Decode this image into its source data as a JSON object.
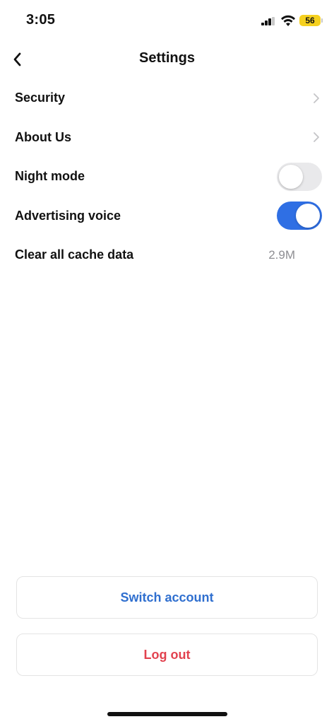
{
  "status_bar": {
    "time": "3:05",
    "battery": "56",
    "battery_color": "#f5d01f",
    "icons": [
      "signal-icon",
      "wifi-icon",
      "battery-icon"
    ]
  },
  "nav": {
    "title": "Settings",
    "back_icon": "chevron-left-icon"
  },
  "settings": {
    "security": {
      "label": "Security",
      "icon": "chevron-right-icon"
    },
    "about": {
      "label": "About Us",
      "icon": "chevron-right-icon"
    },
    "night_mode": {
      "label": "Night mode",
      "enabled": false
    },
    "advertising_voice": {
      "label": "Advertising voice",
      "enabled": true
    },
    "clear_cache": {
      "label": "Clear all cache data",
      "value": "2.9M"
    }
  },
  "buttons": {
    "switch_account": "Switch account",
    "log_out": "Log out"
  },
  "colors": {
    "accent_blue": "#2f6fe4",
    "switch_text": "#2f6fcf",
    "logout_text": "#e2424f",
    "toggle_off": "#e9e9eb"
  }
}
